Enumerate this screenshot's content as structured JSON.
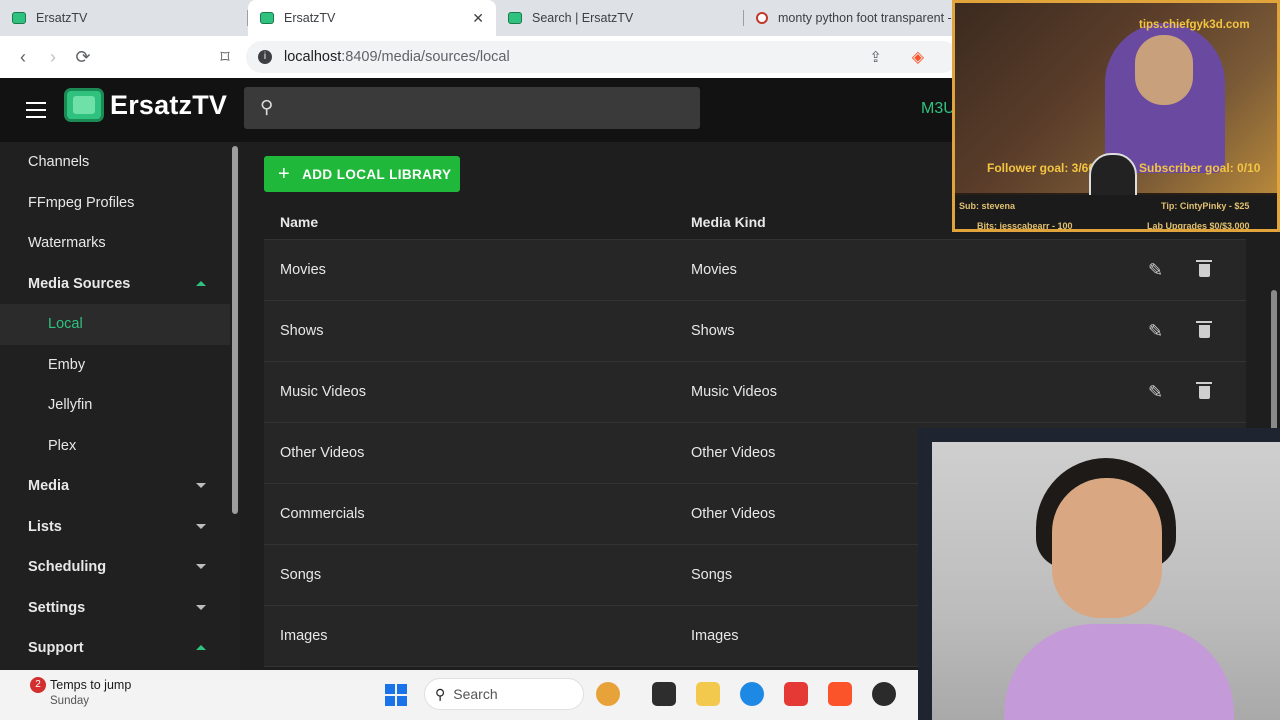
{
  "browser": {
    "tabs": [
      {
        "title": "ErsatzTV",
        "active": false
      },
      {
        "title": "ErsatzTV",
        "active": true
      },
      {
        "title": "Search | ErsatzTV",
        "active": false
      },
      {
        "title": "monty python foot transparent -",
        "active": false
      }
    ],
    "close_glyph": "✕",
    "url_host": "localhost",
    "url_path": ":8409/media/sources/local"
  },
  "app": {
    "name": "ErsatzTV",
    "m3u_label": "M3U"
  },
  "sidebar": {
    "items": [
      {
        "label": "Channels",
        "bold": false
      },
      {
        "label": "FFmpeg Profiles",
        "bold": false
      },
      {
        "label": "Watermarks",
        "bold": false
      },
      {
        "label": "Media Sources",
        "bold": true
      },
      {
        "label": "Local",
        "bold": false
      },
      {
        "label": "Emby",
        "bold": false
      },
      {
        "label": "Jellyfin",
        "bold": false
      },
      {
        "label": "Plex",
        "bold": false
      },
      {
        "label": "Media",
        "bold": true
      },
      {
        "label": "Lists",
        "bold": true
      },
      {
        "label": "Scheduling",
        "bold": true
      },
      {
        "label": "Settings",
        "bold": true
      },
      {
        "label": "Support",
        "bold": true
      }
    ]
  },
  "main": {
    "add_button_label": "ADD LOCAL LIBRARY",
    "columns": [
      "Name",
      "Media Kind"
    ],
    "rows": [
      {
        "name": "Movies",
        "kind": "Movies"
      },
      {
        "name": "Shows",
        "kind": "Shows"
      },
      {
        "name": "Music Videos",
        "kind": "Music Videos"
      },
      {
        "name": "Other Videos",
        "kind": "Other Videos"
      },
      {
        "name": "Commercials",
        "kind": "Other Videos"
      },
      {
        "name": "Songs",
        "kind": "Songs"
      },
      {
        "name": "Images",
        "kind": "Images"
      }
    ]
  },
  "stream_overlay": {
    "tips_url": "tips.chiefgyk3d.com",
    "follower_goal": "Follower goal: 3/60",
    "subscriber_goal": "Subscriber goal: 0/10",
    "sub": "Sub: stevena",
    "tip": "Tip: CintyPinky - $25",
    "bits": "Bits: jesscabearr - 100",
    "lab": "Lab Upgrades $0/$3,000"
  },
  "taskbar": {
    "weather_badge": "2",
    "weather_line1": "Temps to jump",
    "weather_line2": "Sunday",
    "search_label": "Search"
  },
  "colors": {
    "accent": "#2ec27e",
    "add_button": "#20b83a",
    "overlay_gold": "#f4c542"
  }
}
